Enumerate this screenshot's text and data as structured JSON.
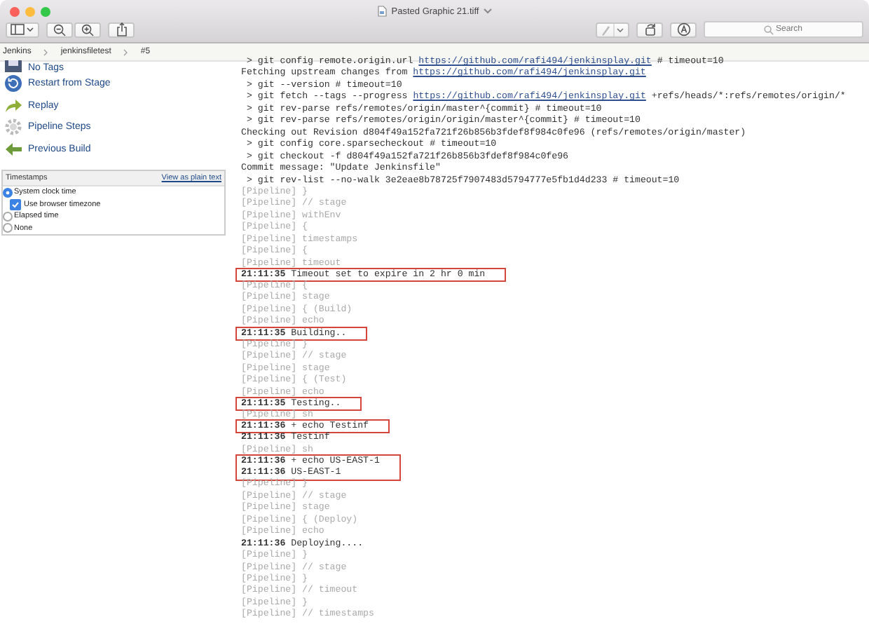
{
  "window": {
    "title": "Pasted Graphic 21.tiff",
    "search_placeholder": "Search"
  },
  "breadcrumbs": [
    "Jenkins",
    "jenkinsfiletest",
    "#5"
  ],
  "sidebar": {
    "items": [
      {
        "label": "No Tags"
      },
      {
        "label": "Restart from Stage"
      },
      {
        "label": "Replay"
      },
      {
        "label": "Pipeline Steps"
      },
      {
        "label": "Previous Build"
      }
    ]
  },
  "timestamps": {
    "title": "Timestamps",
    "link": "View as plain text",
    "options": [
      {
        "kind": "radio",
        "label": "System clock time",
        "selected": true
      },
      {
        "kind": "checkbox",
        "label": "Use browser timezone",
        "checked": true
      },
      {
        "kind": "radio",
        "label": "Elapsed time",
        "selected": false
      },
      {
        "kind": "radio",
        "label": "None",
        "selected": false
      }
    ]
  },
  "console": [
    {
      "kind": "command",
      "text": "> git config remote.origin.url ",
      "link": "https://github.com/rafi494/jenkinsplay.git",
      "after": " # timeout=10",
      "boxed": false
    },
    {
      "kind": "info",
      "text": "Fetching upstream changes from ",
      "link": "https://github.com/rafi494/jenkinsplay.git",
      "boxed": false
    },
    {
      "kind": "command",
      "text": "> git --version # timeout=10",
      "boxed": false
    },
    {
      "kind": "command",
      "text": "> git fetch --tags --progress ",
      "link": "https://github.com/rafi494/jenkinsplay.git",
      "after": " +refs/heads/*:refs/remotes/origin/*",
      "boxed": false
    },
    {
      "kind": "command",
      "text": "> git rev-parse refs/remotes/origin/master^{commit} # timeout=10",
      "boxed": false
    },
    {
      "kind": "command",
      "text": "> git rev-parse refs/remotes/origin/origin/master^{commit} # timeout=10",
      "boxed": false
    },
    {
      "kind": "info",
      "text": "Checking out Revision d804f49a152fa721f26b856b3fdef8f984c0fe96 (refs/remotes/origin/master)",
      "boxed": false
    },
    {
      "kind": "command",
      "text": "> git config core.sparsecheckout # timeout=10",
      "boxed": false
    },
    {
      "kind": "command",
      "text": "> git checkout -f d804f49a152fa721f26b856b3fdef8f984c0fe96",
      "boxed": false
    },
    {
      "kind": "info",
      "text": "Commit message: \"Update Jenkinsfile\"",
      "boxed": false
    },
    {
      "kind": "command",
      "text": "> git rev-list --no-walk 3e2eae8b78725f7907483d5794777e5fb1d4d233 # timeout=10",
      "boxed": false
    },
    {
      "kind": "pipeline",
      "text": "[Pipeline] }",
      "boxed": false
    },
    {
      "kind": "pipeline",
      "text": "[Pipeline] // stage",
      "boxed": false
    },
    {
      "kind": "pipeline",
      "text": "[Pipeline] withEnv",
      "boxed": false
    },
    {
      "kind": "pipeline",
      "text": "[Pipeline] {",
      "boxed": false
    },
    {
      "kind": "pipeline",
      "text": "[Pipeline] timestamps",
      "boxed": false
    },
    {
      "kind": "pipeline",
      "text": "[Pipeline] {",
      "boxed": false
    },
    {
      "kind": "pipeline",
      "text": "[Pipeline] timeout",
      "boxed": false
    },
    {
      "kind": "timed",
      "time": "21:11:35",
      "text": " Timeout set to expire in 2 hr 0 min",
      "boxed": true
    },
    {
      "kind": "pipeline",
      "text": "[Pipeline] {",
      "boxed": false
    },
    {
      "kind": "pipeline",
      "text": "[Pipeline] stage",
      "boxed": false
    },
    {
      "kind": "pipeline",
      "text": "[Pipeline] { (Build)",
      "boxed": false
    },
    {
      "kind": "pipeline",
      "text": "[Pipeline] echo",
      "boxed": false
    },
    {
      "kind": "timed",
      "time": "21:11:35",
      "text": " Building..",
      "boxed": true
    },
    {
      "kind": "pipeline",
      "text": "[Pipeline] }",
      "boxed": false
    },
    {
      "kind": "pipeline",
      "text": "[Pipeline] // stage",
      "boxed": false
    },
    {
      "kind": "pipeline",
      "text": "[Pipeline] stage",
      "boxed": false
    },
    {
      "kind": "pipeline",
      "text": "[Pipeline] { (Test)",
      "boxed": false
    },
    {
      "kind": "pipeline",
      "text": "[Pipeline] echo",
      "boxed": false
    },
    {
      "kind": "timed",
      "time": "21:11:35",
      "text": " Testing..",
      "boxed": true
    },
    {
      "kind": "pipeline",
      "text": "[Pipeline] sh",
      "boxed": false
    },
    {
      "kind": "timed",
      "time": "21:11:36",
      "text": " + echo Testinf",
      "boxed": true
    },
    {
      "kind": "timed",
      "time": "21:11:36",
      "text": " Testinf",
      "boxed": false
    },
    {
      "kind": "pipeline",
      "text": "[Pipeline] sh",
      "boxed": false
    },
    {
      "kind": "timed",
      "time": "21:11:36",
      "text": " + echo US-EAST-1",
      "boxed": true
    },
    {
      "kind": "timed",
      "time": "21:11:36",
      "text": " US-EAST-1",
      "boxed": true
    },
    {
      "kind": "pipeline",
      "text": "[Pipeline] }",
      "boxed": false
    },
    {
      "kind": "pipeline",
      "text": "[Pipeline] // stage",
      "boxed": false
    },
    {
      "kind": "pipeline",
      "text": "[Pipeline] stage",
      "boxed": false
    },
    {
      "kind": "pipeline",
      "text": "[Pipeline] { (Deploy)",
      "boxed": false
    },
    {
      "kind": "pipeline",
      "text": "[Pipeline] echo",
      "boxed": false
    },
    {
      "kind": "timed",
      "time": "21:11:36",
      "text": " Deploying....",
      "boxed": false
    },
    {
      "kind": "pipeline",
      "text": "[Pipeline] }",
      "boxed": false
    },
    {
      "kind": "pipeline",
      "text": "[Pipeline] // stage",
      "boxed": false
    },
    {
      "kind": "pipeline",
      "text": "[Pipeline] }",
      "boxed": false
    },
    {
      "kind": "pipeline",
      "text": "[Pipeline] // timeout",
      "boxed": false
    },
    {
      "kind": "pipeline",
      "text": "[Pipeline] }",
      "boxed": false
    },
    {
      "kind": "pipeline",
      "text": "[Pipeline] // timestamps",
      "boxed": false
    }
  ]
}
